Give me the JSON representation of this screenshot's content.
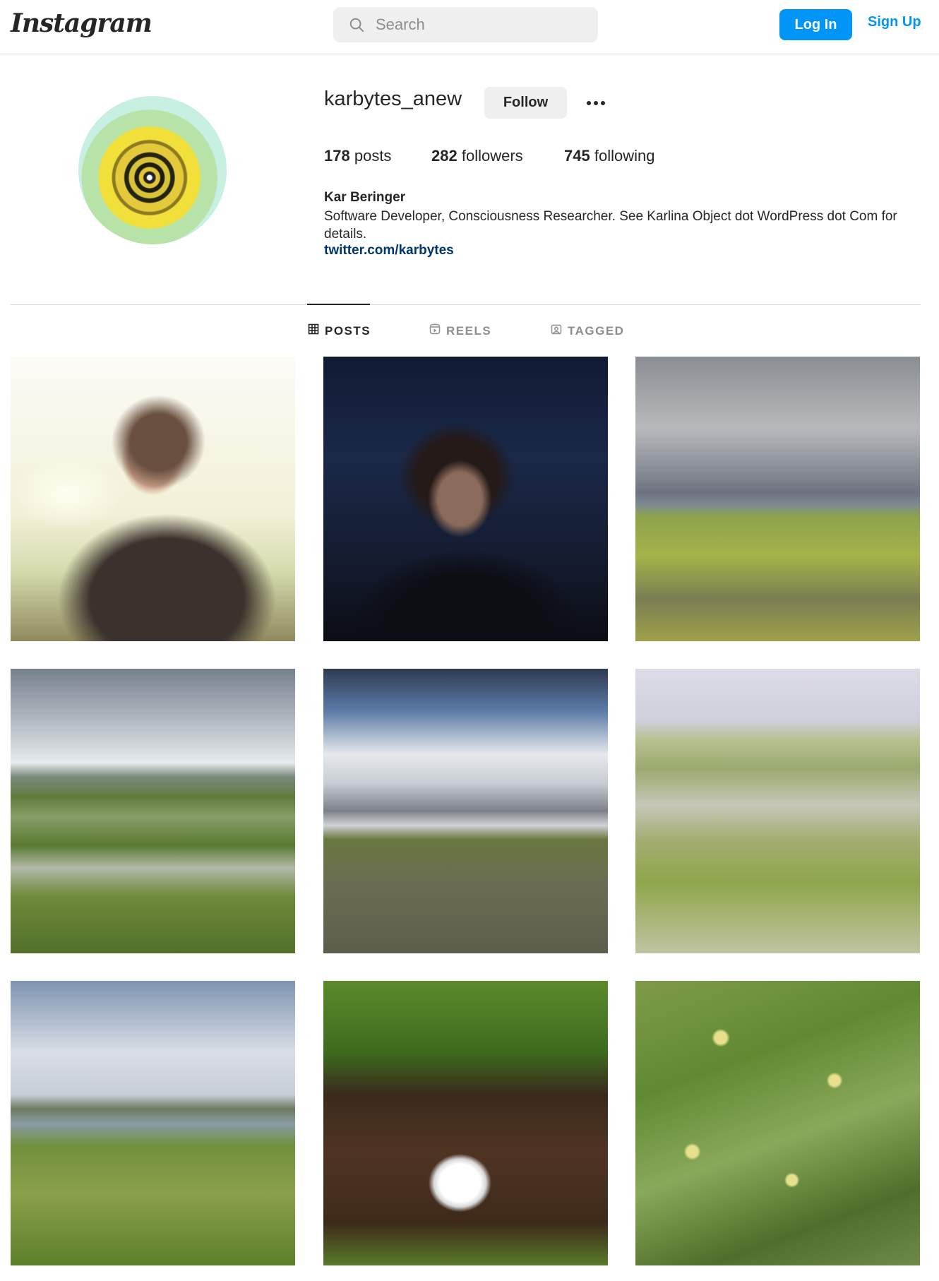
{
  "header": {
    "logo": "Instagram",
    "search_placeholder": "Search",
    "login_label": "Log In",
    "signup_label": "Sign Up"
  },
  "profile": {
    "username": "karbytes_anew",
    "follow_label": "Follow",
    "posts_count": "178",
    "posts_label": "posts",
    "followers_count": "282",
    "followers_label": "followers",
    "following_count": "745",
    "following_label": "following",
    "full_name": "Kar Beringer",
    "bio": "Software Developer, Consciousness Researcher. See Karlina Object dot WordPress dot Com for details.",
    "link": "twitter.com/karbytes"
  },
  "tabs": [
    {
      "label": "POSTS",
      "icon": "grid-icon",
      "active": true
    },
    {
      "label": "REELS",
      "icon": "reels-icon",
      "active": false
    },
    {
      "label": "TAGGED",
      "icon": "tagged-icon",
      "active": false
    }
  ],
  "colors": {
    "accent": "#0095f6",
    "link": "#00376b",
    "border": "#dbdbdb"
  }
}
